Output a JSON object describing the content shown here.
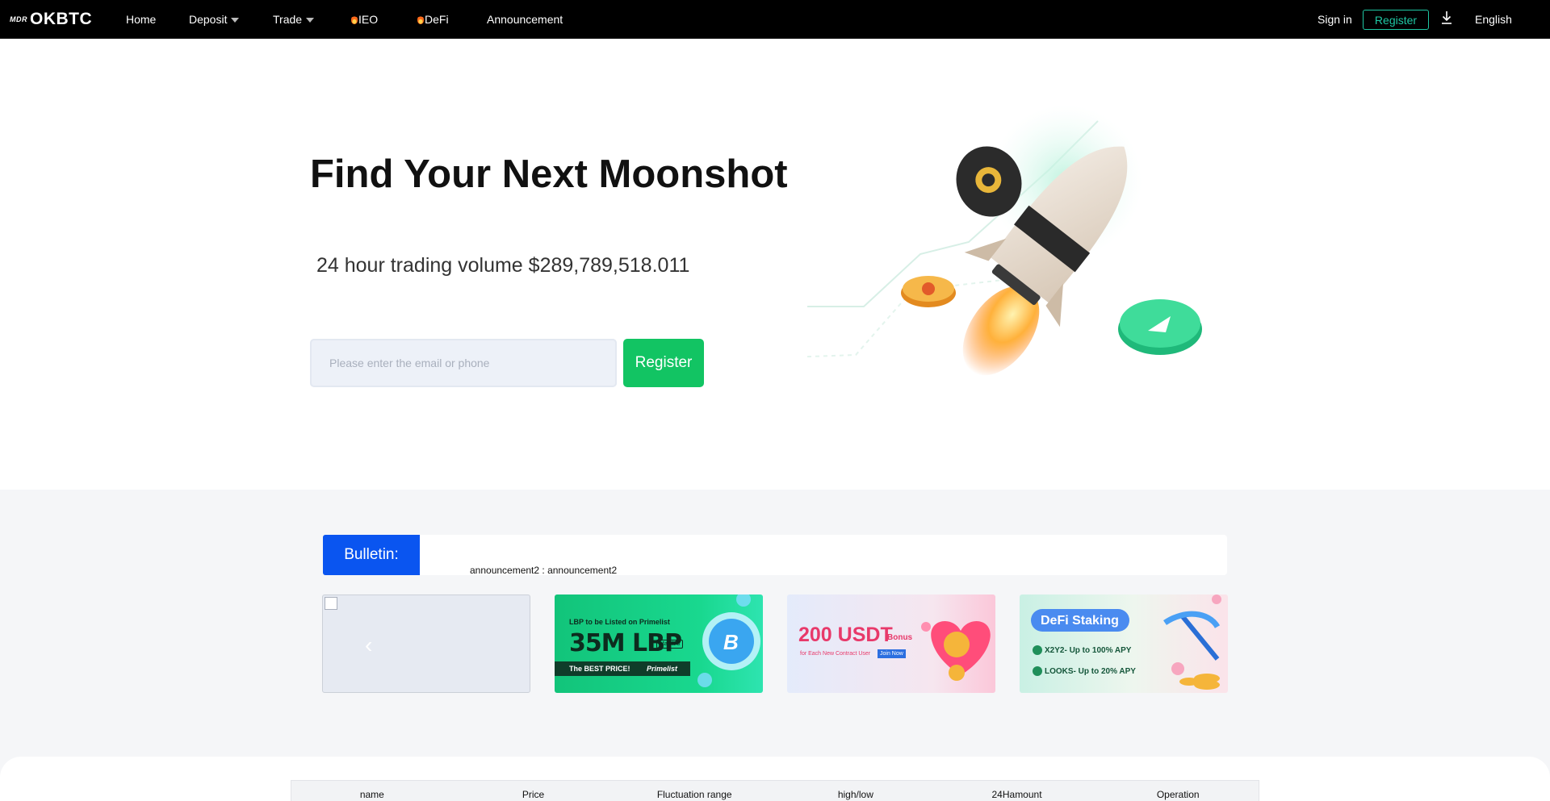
{
  "nav": {
    "logo_mark": "MDR",
    "logo_text": "OKBTC",
    "home": "Home",
    "deposit": "Deposit",
    "trade": "Trade",
    "ieo": "IEO",
    "defi": "DeFi",
    "announcement": "Announcement",
    "sign_in": "Sign in",
    "register": "Register",
    "language": "English"
  },
  "hero": {
    "title": "Find Your Next Moonshot",
    "volume": "24 hour trading volume $289,789,518.011",
    "input_placeholder": "Please enter the email or phone",
    "register": "Register"
  },
  "bulletin": {
    "label": "Bulletin:",
    "text": "announcement2 : announcement2"
  },
  "banners": [
    {
      "line1": "LBP to be Listed on Primelist",
      "big": "35M LBP",
      "date": "March 8",
      "line2": "The BEST PRICE!",
      "brand": "Primelist"
    },
    {
      "big": "200 USDT",
      "bonus": "Bonus",
      "line2": "for Each New Contract User",
      "cta": "Join Now"
    },
    {
      "title": "DeFi Staking",
      "item1": "X2Y2- Up to 100% APY",
      "item2": "LOOKS- Up to 20% APY"
    }
  ],
  "table": {
    "headers": [
      "name",
      "Price",
      "Fluctuation range",
      "high/low",
      "24Hamount",
      "Operation"
    ]
  },
  "colors": {
    "nav_bg": "#000000",
    "accent_green": "#12c463",
    "bulletin_blue": "#0a55f0",
    "nav_register_border": "#1fc7a4"
  }
}
